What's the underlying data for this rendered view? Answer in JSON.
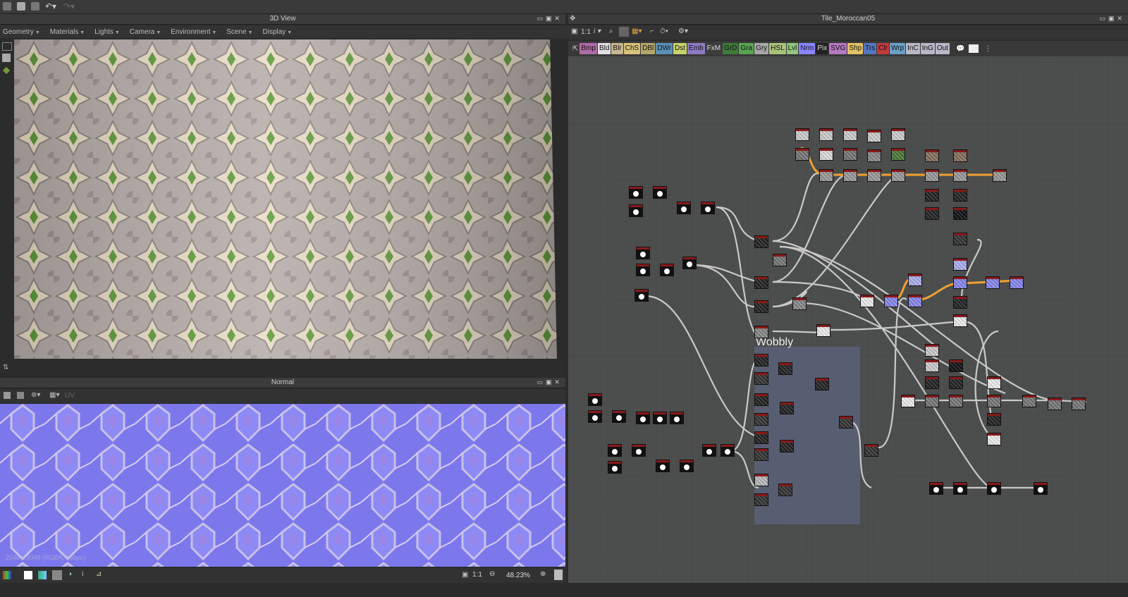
{
  "left_top_panel": {
    "title": "3D View",
    "menus": [
      "Geometry",
      "Materials",
      "Lights",
      "Camera",
      "Environment",
      "Scene",
      "Display"
    ]
  },
  "left_bottom_panel": {
    "title": "Normal",
    "toolbar_hint": "UV",
    "status_text": "2048 x 2048 (RGBA, 16bpc)",
    "ratio_label": "1:1",
    "zoom": "48.23%"
  },
  "graph_panel": {
    "title": "Tile_Moroccan05",
    "zoom_label": "1:1",
    "frame_title": "Wobbly",
    "chips": [
      {
        "label": "Bmp",
        "color": "#b06aa6"
      },
      {
        "label": "Bld",
        "color": "#e0e0e0"
      },
      {
        "label": "Blr",
        "color": "#c8b78f"
      },
      {
        "label": "ChS",
        "color": "#d7c27a"
      },
      {
        "label": "DBl",
        "color": "#b5a76b"
      },
      {
        "label": "DWr",
        "color": "#5b8fb5"
      },
      {
        "label": "Dst",
        "color": "#c6d46a"
      },
      {
        "label": "Emb",
        "color": "#8c7cc4"
      },
      {
        "label": "FxM",
        "color": "#3d3d3d"
      },
      {
        "label": "GrD",
        "color": "#3f7a3a"
      },
      {
        "label": "Gra",
        "color": "#5aa552"
      },
      {
        "label": "Gry",
        "color": "#a8a8a8"
      },
      {
        "label": "HSL",
        "color": "#a9c37a"
      },
      {
        "label": "Lvl",
        "color": "#8fc77c"
      },
      {
        "label": "Nrm",
        "color": "#8a85ff"
      },
      {
        "label": "Pix",
        "color": "#222222"
      },
      {
        "label": "SVG",
        "color": "#b678c1"
      },
      {
        "label": "Shp",
        "color": "#e2c266"
      },
      {
        "label": "Trs",
        "color": "#5577c0"
      },
      {
        "label": "Clr",
        "color": "#c23a3a"
      },
      {
        "label": "Wrp",
        "color": "#6aa0c8"
      },
      {
        "label": "InC",
        "color": "#b8b8c8"
      },
      {
        "label": "InG",
        "color": "#b8b8c8"
      },
      {
        "label": "Out",
        "color": "#b8b8c8"
      }
    ]
  },
  "colors": {
    "accent_orange": "#f0a030",
    "node_header_red": "#8a1a1a",
    "frame_blue": "#5a6178"
  }
}
